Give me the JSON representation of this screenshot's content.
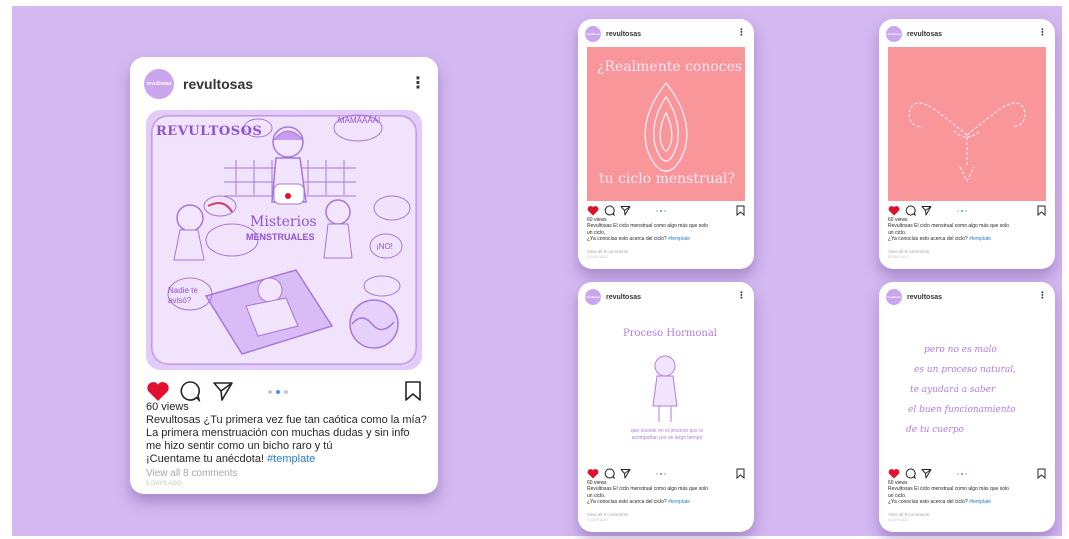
{
  "main_post": {
    "username": "revultosas",
    "avatar_text": "revultosas",
    "more_glyph": "⋮",
    "illustration": {
      "title": "REVULTOSOS",
      "center_text_1": "Misterios",
      "center_text_2": "MENSTRUALES",
      "bubble_1": "MAMÁÁÁÁ!",
      "bubble_2": "¡NO! ",
      "bubble_3": "Nadie te avisó?"
    },
    "views": "60 views",
    "caption_lines": [
      "Revultosas ¿Tu primera vez fue tan caótica como la mía?",
      "La primera menstruación con muchas dudas y sin info",
      "me hizo sentir como un bicho raro y tú",
      "¡Cuentame tu anécdota!"
    ],
    "hashtag": "#template",
    "comments_link": "View all 8 comments",
    "timestamp": "5 DAYS AGO"
  },
  "small_posts": [
    {
      "username": "revultosas",
      "avatar_text": "revultosas",
      "media_text_top": "¿Realmente conoces",
      "media_text_bottom": "tu ciclo menstrual?",
      "views": "60 views",
      "caption_lines": [
        "Revultosas El ciclo menstrual como algo más que solo",
        "un ciclo.",
        "¿Ya conocías esto acerca del ciclo?"
      ],
      "hashtag": "#template",
      "comments_link": "View all 8 comments",
      "timestamp": "5 DAYS AGO"
    },
    {
      "username": "revultosas",
      "avatar_text": "revultosas",
      "views": "60 views",
      "caption_lines": [
        "Revultosas El ciclo menstrual como algo más que solo",
        "un ciclo.",
        "¿Ya conocías esto acerca del ciclo?"
      ],
      "hashtag": "#template",
      "comments_link": "View all 8 comments",
      "timestamp": "5 DAYS AGO"
    },
    {
      "username": "revultosas",
      "avatar_text": "revultosas",
      "media_text_top": "Proceso Hormonal",
      "media_text_bottom": "que sucede en el proceso que lo acompañan por un largo tiempo",
      "views": "60 views",
      "caption_lines": [
        "Revultosas El ciclo menstrual como algo más que solo",
        "un ciclo.",
        "¿Ya conocías esto acerca del ciclo?"
      ],
      "hashtag": "#template",
      "comments_link": "View all 8 comments",
      "timestamp": "5 DAYS AGO"
    },
    {
      "username": "revultosas",
      "avatar_text": "revultosas",
      "media_lines": [
        "pero no es malo",
        "es un proceso natural,",
        "te ayudará a saber",
        "el buen funcionamiento",
        "de tu cuerpo"
      ],
      "views": "60 views",
      "caption_lines": [
        "Revultosas El ciclo menstrual como algo más que solo",
        "un ciclo.",
        "¿Ya conocías esto acerca del ciclo?"
      ],
      "hashtag": "#template",
      "comments_link": "View all 8 comments",
      "timestamp": "5 DAYS AGO"
    }
  ],
  "colors": {
    "background": "#d3b8f1",
    "heart": "#e0102e",
    "pink_media": "#f8969a",
    "illustration_bg": "#e3ccf8",
    "hashtag": "#2a7fc3"
  },
  "icons": [
    "heart-icon",
    "comment-icon",
    "share-icon",
    "bookmark-icon",
    "more-icon"
  ]
}
